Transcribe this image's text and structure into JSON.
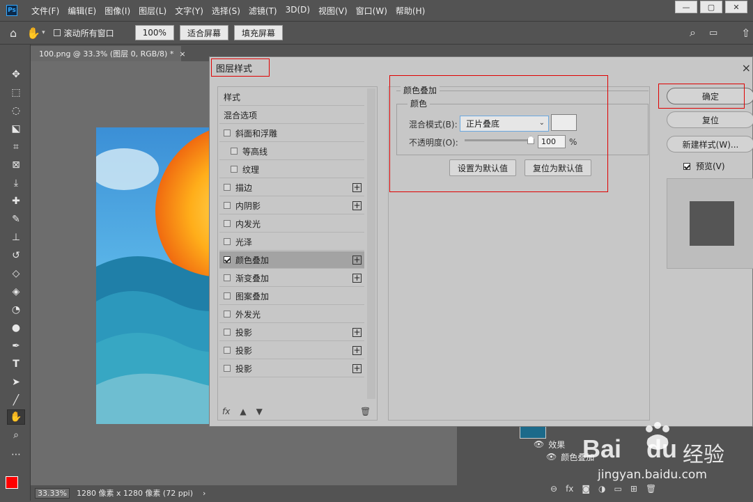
{
  "app": {
    "logo": "Ps",
    "menus": [
      "文件(F)",
      "编辑(E)",
      "图像(I)",
      "图层(L)",
      "文字(Y)",
      "选择(S)",
      "滤镜(T)",
      "3D(D)",
      "视图(V)",
      "窗口(W)",
      "帮助(H)"
    ]
  },
  "options_bar": {
    "scroll_all_label": "滚动所有窗口",
    "zoom_100": "100%",
    "fit_screen": "适合屏幕",
    "fill_screen": "填充屏幕"
  },
  "document": {
    "tab_title": "100.png @ 33.3% (图层 0, RGB/8) *",
    "tab_close": "×"
  },
  "status": {
    "zoom": "33.33%",
    "size": "1280 像素 x 1280 像素 (72 ppi)",
    "arrow": "›"
  },
  "layers": {
    "effects_label": "效果",
    "effect_item": "颜色叠加",
    "tool_icons": [
      "⊖",
      "fx",
      "◙",
      "◑",
      "▭",
      "⊞",
      "🗑"
    ]
  },
  "dialog": {
    "title": "图层样式",
    "close": "×",
    "style_list": [
      {
        "label": "样式",
        "type": "header"
      },
      {
        "label": "混合选项",
        "type": "header"
      },
      {
        "label": "斜面和浮雕",
        "checked": false,
        "plus": false,
        "indent": false
      },
      {
        "label": "等高线",
        "checked": false,
        "plus": false,
        "indent": true
      },
      {
        "label": "纹理",
        "checked": false,
        "plus": false,
        "indent": true
      },
      {
        "label": "描边",
        "checked": false,
        "plus": true,
        "indent": false
      },
      {
        "label": "内阴影",
        "checked": false,
        "plus": true,
        "indent": false
      },
      {
        "label": "内发光",
        "checked": false,
        "plus": false,
        "indent": false
      },
      {
        "label": "光泽",
        "checked": false,
        "plus": false,
        "indent": false
      },
      {
        "label": "颜色叠加",
        "checked": true,
        "plus": true,
        "indent": false,
        "selected": true
      },
      {
        "label": "渐变叠加",
        "checked": false,
        "plus": true,
        "indent": false
      },
      {
        "label": "图案叠加",
        "checked": false,
        "plus": false,
        "indent": false
      },
      {
        "label": "外发光",
        "checked": false,
        "plus": false,
        "indent": false
      },
      {
        "label": "投影",
        "checked": false,
        "plus": true,
        "indent": false
      },
      {
        "label": "投影",
        "checked": false,
        "plus": true,
        "indent": false
      },
      {
        "label": "投影",
        "checked": false,
        "plus": true,
        "indent": false
      }
    ],
    "list_footer": {
      "fx": "fx",
      "up": "▲",
      "down": "▼",
      "trash": "🗑"
    },
    "panel": {
      "section_title": "颜色叠加",
      "group_title": "颜色",
      "blend_label": "混合模式(B):",
      "blend_value": "正片叠底",
      "opacity_label": "不透明度(O):",
      "opacity_value": "100",
      "opacity_percent": 1.0,
      "percent_sign": "%",
      "swatch_color": "#ececec",
      "set_default": "设置为默认值",
      "reset_default": "复位为默认值"
    },
    "buttons": {
      "ok": "确定",
      "reset": "复位",
      "new_style": "新建样式(W)...",
      "preview_label": "预览(V)",
      "preview_checked": true
    },
    "preview_color": "#555555"
  },
  "watermark": {
    "brand": "Bai",
    "brand2": "du",
    "cn": "经验",
    "url": "jingyan.baidu.com"
  }
}
